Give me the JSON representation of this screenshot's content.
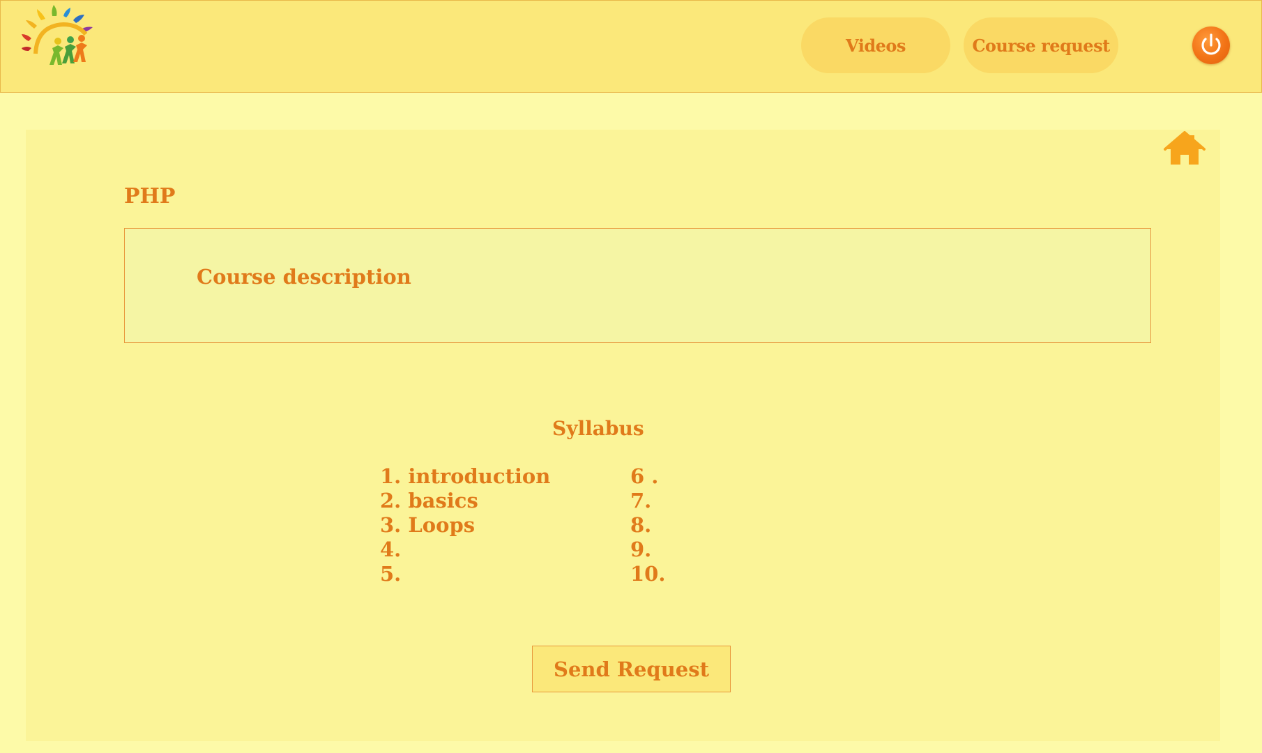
{
  "header": {
    "nav": [
      {
        "label": "Videos"
      },
      {
        "label": "Course request"
      }
    ]
  },
  "icons": {
    "logo": "sun-family-logo",
    "power": "power-icon",
    "home": "home-icon"
  },
  "colors": {
    "accent": "#e07a1a",
    "header_bg": "#fbe87a",
    "page_bg": "#fdfaa8",
    "panel_bg": "#fbf498",
    "power_button": "#f27316",
    "home_icon": "#f7a51c"
  },
  "course": {
    "title": "PHP",
    "description_heading": "Course description"
  },
  "syllabus": {
    "title": "Syllabus",
    "left_items": [
      "1. introduction",
      "2. basics",
      "3. Loops",
      "4.",
      "5."
    ],
    "right_items": [
      "6 .",
      "7.",
      "8.",
      "9.",
      "10."
    ]
  },
  "actions": {
    "send_request": "Send Request"
  }
}
